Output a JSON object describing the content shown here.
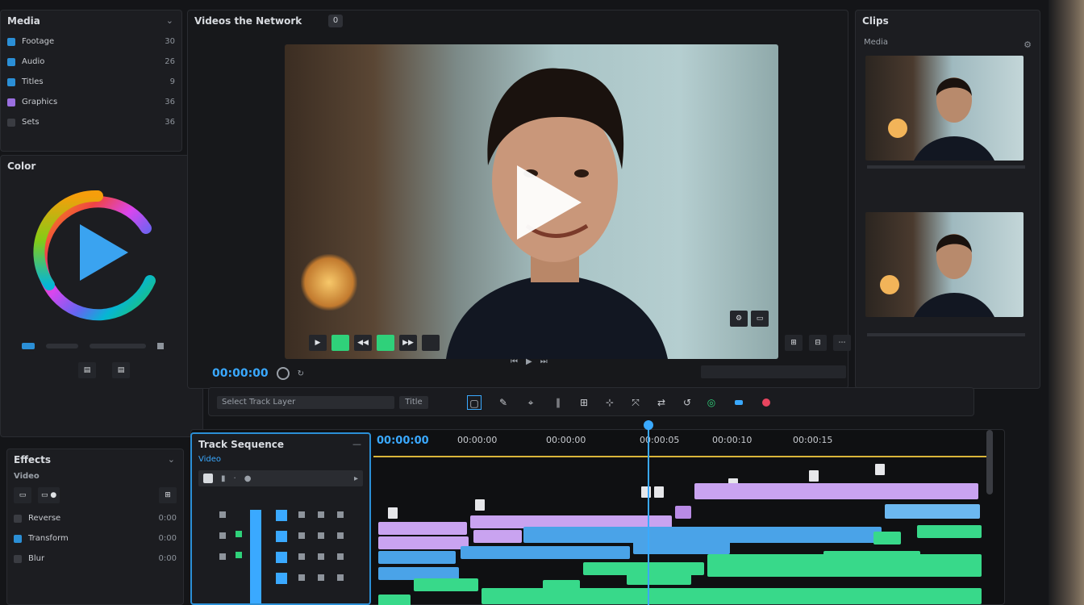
{
  "media_panel": {
    "title": "Media",
    "items": [
      {
        "label": "Footage",
        "value": "30",
        "color": "#2b8fd6"
      },
      {
        "label": "Audio",
        "value": "26",
        "color": "#2b8fd6"
      },
      {
        "label": "Titles",
        "value": "9",
        "color": "#2b8fd6"
      },
      {
        "label": "Graphics",
        "value": "36",
        "color": "#9a6fe0"
      },
      {
        "label": "Sets",
        "value": "36",
        "color": "#3a3c42"
      }
    ]
  },
  "wheel_panel": {
    "title": "Color",
    "label_left": "",
    "label_mid": "",
    "colors": [
      "#ef4444",
      "#f59e0b",
      "#84cc16",
      "#22c55e",
      "#06b6d4",
      "#3b82f6",
      "#a855f7"
    ]
  },
  "viewer": {
    "title": "Videos the Network",
    "badge": "0",
    "timecode": "00:00:00",
    "controls": [
      "▶",
      "",
      "◀◀",
      "",
      "▶▶",
      ""
    ]
  },
  "right_panel": {
    "title": "Clips",
    "subtitle": "Media"
  },
  "toolbar": {
    "label": "Select Track Layer",
    "field": "Title",
    "tools": [
      "▢",
      "✎",
      "⌖",
      "∥",
      "⊞",
      "⊹",
      "⤧",
      "⇄",
      "↺",
      "◎"
    ]
  },
  "bottom_left": {
    "title": "Effects",
    "subtitle": "Video",
    "items": [
      {
        "label": "Reverse",
        "value": "0:00"
      },
      {
        "label": "Transform",
        "value": "0:00"
      },
      {
        "label": "Blur",
        "value": "0:00"
      }
    ]
  },
  "track_panel": {
    "title": "Track Sequence",
    "subtitle": "Video"
  },
  "timeline": {
    "timecode": "00:00:00",
    "ruler_labels": [
      "00:00:00",
      "00:00:00",
      "00:00:05",
      "00:00:10",
      "00:00:15"
    ]
  }
}
